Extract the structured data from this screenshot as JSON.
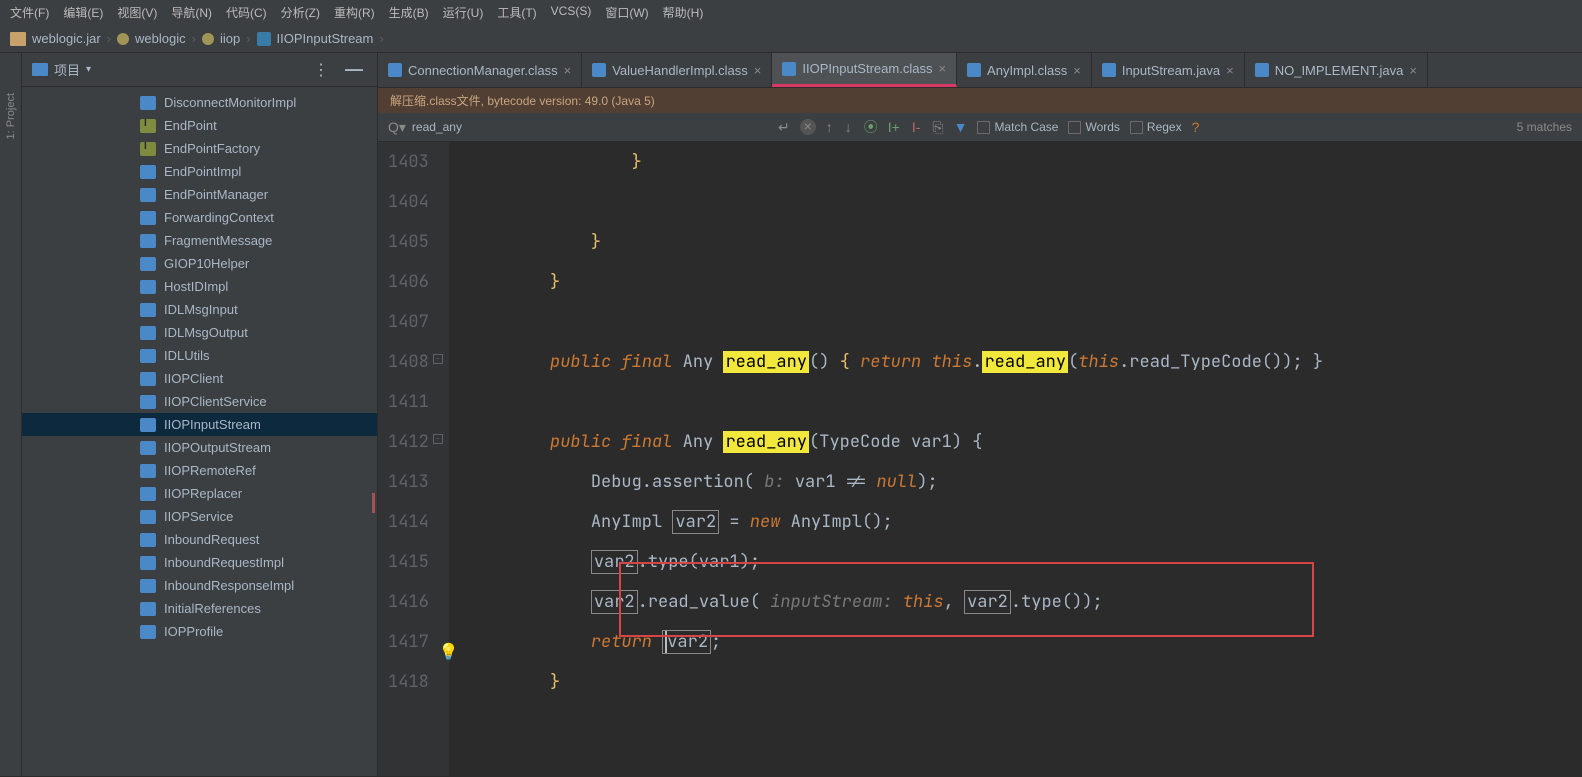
{
  "menu": [
    "文件(F)",
    "编辑(E)",
    "视图(V)",
    "导航(N)",
    "代码(C)",
    "分析(Z)",
    "重构(R)",
    "生成(B)",
    "运行(U)",
    "工具(T)",
    "VCS(S)",
    "窗口(W)",
    "帮助(H)"
  ],
  "breadcrumb": [
    "weblogic.jar",
    "weblogic",
    "iiop",
    "IIOPInputStream"
  ],
  "sidebar_title": "项目",
  "leftrail_label": "1: Project",
  "tree": [
    {
      "name": "DisconnectMonitorImpl",
      "kind": "cls"
    },
    {
      "name": "EndPoint",
      "kind": "iface"
    },
    {
      "name": "EndPointFactory",
      "kind": "iface"
    },
    {
      "name": "EndPointImpl",
      "kind": "cls"
    },
    {
      "name": "EndPointManager",
      "kind": "cls"
    },
    {
      "name": "ForwardingContext",
      "kind": "cls"
    },
    {
      "name": "FragmentMessage",
      "kind": "cls"
    },
    {
      "name": "GIOP10Helper",
      "kind": "cls"
    },
    {
      "name": "HostIDImpl",
      "kind": "cls"
    },
    {
      "name": "IDLMsgInput",
      "kind": "cls"
    },
    {
      "name": "IDLMsgOutput",
      "kind": "cls"
    },
    {
      "name": "IDLUtils",
      "kind": "cls"
    },
    {
      "name": "IIOPClient",
      "kind": "cls"
    },
    {
      "name": "IIOPClientService",
      "kind": "cls"
    },
    {
      "name": "IIOPInputStream",
      "kind": "cls",
      "selected": true
    },
    {
      "name": "IIOPOutputStream",
      "kind": "cls"
    },
    {
      "name": "IIOPRemoteRef",
      "kind": "cls"
    },
    {
      "name": "IIOPReplacer",
      "kind": "cls"
    },
    {
      "name": "IIOPService",
      "kind": "cls"
    },
    {
      "name": "InboundRequest",
      "kind": "cls"
    },
    {
      "name": "InboundRequestImpl",
      "kind": "cls"
    },
    {
      "name": "InboundResponseImpl",
      "kind": "cls"
    },
    {
      "name": "InitialReferences",
      "kind": "cls"
    },
    {
      "name": "IOPProfile",
      "kind": "cls"
    }
  ],
  "tabs": [
    {
      "label": "ConnectionManager.class"
    },
    {
      "label": "ValueHandlerImpl.class"
    },
    {
      "label": "IIOPInputStream.class",
      "active": true
    },
    {
      "label": "AnyImpl.class"
    },
    {
      "label": "InputStream.java"
    },
    {
      "label": "NO_IMPLEMENT.java"
    }
  ],
  "banner": "解压缩.class文件, bytecode version: 49.0 (Java 5)",
  "find": {
    "query": "read_any",
    "match_case": "Match Case",
    "words": "Words",
    "regex": "Regex",
    "matches": "5 matches"
  },
  "lines": [
    "1403",
    "1404",
    "1405",
    "1406",
    "1407",
    "1408",
    "1411",
    "1412",
    "1413",
    "1414",
    "1415",
    "1416",
    "1417",
    "1418"
  ],
  "code": {
    "l1408_pre": "public final",
    "l1408_type": "Any",
    "l1408_m": "read_any",
    "l1408_ret": "return",
    "l1408_this": "this",
    "l1408_m2": "read_any",
    "l1408_this2": "this",
    "l1408_rest": ".read_TypeCode()); }",
    "l1412_pre": "public final",
    "l1412_type": "Any",
    "l1412_m": "read_any",
    "l1412_sig": "(TypeCode var1) {",
    "l1413_a": "Debug.assertion(",
    "l1413_hint": " b:",
    "l1413_b": "var1 != ",
    "l1413_null": "null",
    "l1413_c": ");",
    "l1414_a": "AnyImpl ",
    "l1414_var": "var2",
    "l1414_b": " = ",
    "l1414_new": "new",
    "l1414_c": " AnyImpl();",
    "l1415_var": "var2",
    "l1415_a": ".type(var1);",
    "l1416_var": "var2",
    "l1416_a": ".read_value(",
    "l1416_hint": " inputStream:",
    "l1416_this": "this",
    "l1416_b": ", ",
    "l1416_var2": "var2",
    "l1416_c": ".type());",
    "l1417_ret": "return ",
    "l1417_var": "var2",
    "l1417_semi": ";"
  }
}
